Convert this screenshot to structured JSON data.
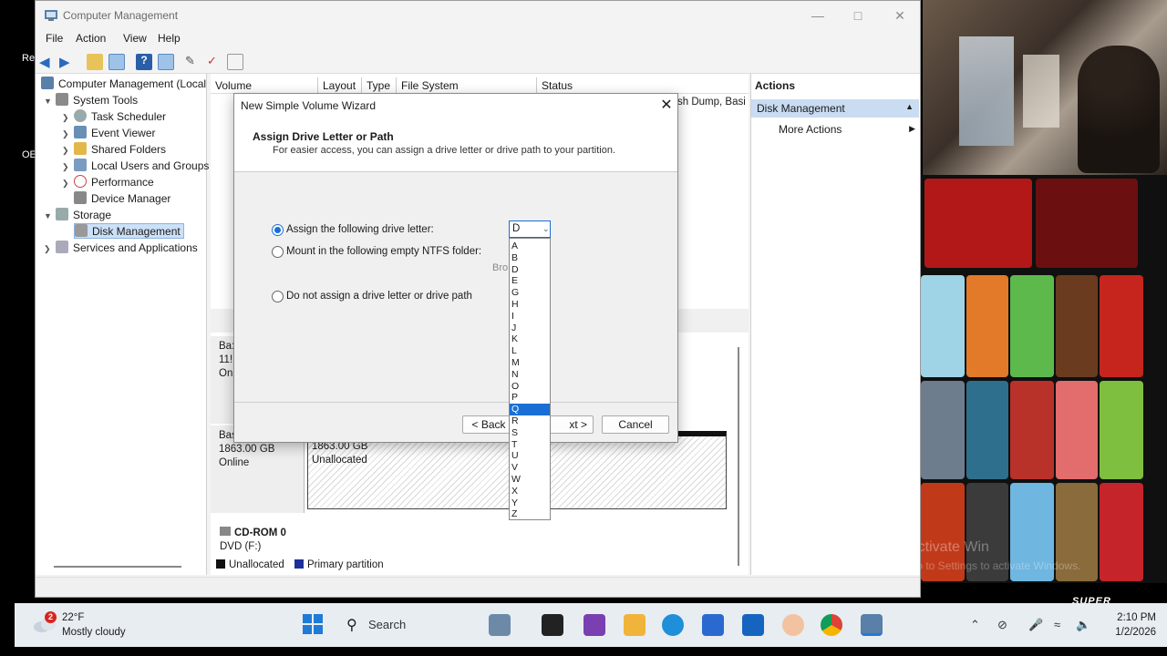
{
  "window": {
    "title": "Computer Management",
    "menu": [
      "File",
      "Action",
      "View",
      "Help"
    ]
  },
  "tree": {
    "root": "Computer Management (Local",
    "items": [
      {
        "label": "System Tools"
      },
      {
        "label": "Task Scheduler"
      },
      {
        "label": "Event Viewer"
      },
      {
        "label": "Shared Folders"
      },
      {
        "label": "Local Users and Groups"
      },
      {
        "label": "Performance"
      },
      {
        "label": "Device Manager"
      },
      {
        "label": "Storage"
      },
      {
        "label": "Disk Management"
      },
      {
        "label": "Services and Applications"
      }
    ]
  },
  "volume_table": {
    "columns": [
      "Volume",
      "Layout",
      "Type",
      "File System",
      "Status"
    ],
    "status_partial": "sh Dump, Basi"
  },
  "disks": {
    "disk1_partial": [
      "Ba:",
      "11!",
      "On"
    ],
    "disk2": {
      "type": "Basic",
      "size": "1863.00 GB",
      "state": "Online"
    },
    "disk2_partition": {
      "size": "1863.00 GB",
      "label": "Unallocated"
    },
    "cdrom": {
      "name": "CD-ROM 0",
      "detail": "DVD (F:)"
    }
  },
  "legend": [
    {
      "label": "Unallocated",
      "color": "#111111"
    },
    {
      "label": "Primary partition",
      "color": "#1c2f9a"
    }
  ],
  "actions": {
    "header": "Actions",
    "selected": "Disk Management",
    "more": "More Actions"
  },
  "wizard": {
    "title": "New Simple Volume Wizard",
    "heading": "Assign Drive Letter or Path",
    "subtitle": "For easier access, you can assign a drive letter or drive path to your partition.",
    "option_assign": "Assign the following drive letter:",
    "option_mount": "Mount in the following empty NTFS folder:",
    "option_none": "Do not assign a drive letter or drive path",
    "browse": "Bro",
    "combo_value": "D",
    "letters": [
      "A",
      "B",
      "D",
      "E",
      "G",
      "H",
      "I",
      "J",
      "K",
      "L",
      "M",
      "N",
      "O",
      "P",
      "Q",
      "R",
      "S",
      "T",
      "U",
      "V",
      "W",
      "X",
      "Y",
      "Z"
    ],
    "highlighted_letter": "Q",
    "back": "< Back",
    "next": "xt >",
    "cancel": "Cancel"
  },
  "desktop_fragments": {
    "re": "Re",
    "ob": "OE"
  },
  "overlay": {
    "activate": "Activate Win",
    "activate2": "Go to Settings to activate Windows.",
    "brand": "SUPER"
  },
  "taskbar": {
    "temp": "22°F",
    "condition": "Mostly cloudy",
    "badge": "2",
    "search": "Search",
    "time": "2:10 PM",
    "date": "1/2/2026"
  }
}
